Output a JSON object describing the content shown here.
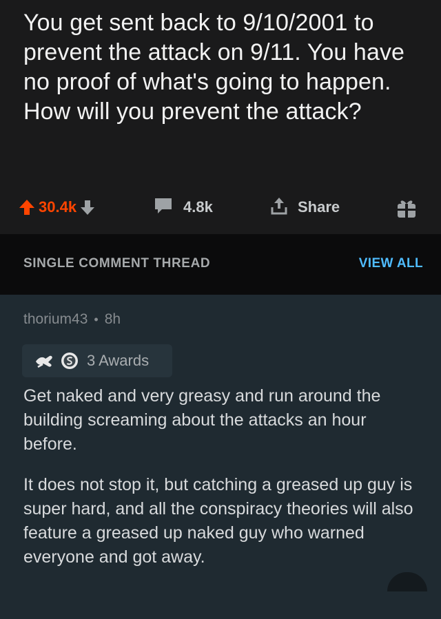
{
  "post": {
    "title": "You get sent back to 9/10/2001 to prevent the attack on 9/11. You have no proof of what's going to happen. How will you prevent the attack?",
    "score": "30.4k",
    "comments_count": "4.8k",
    "share_label": "Share",
    "upvote_color": "#ff4500"
  },
  "thread": {
    "label": "SINGLE COMMENT THREAD",
    "view_all": "VIEW ALL",
    "link_color": "#4fbcff"
  },
  "comment": {
    "author": "thorium43",
    "separator": "•",
    "age": "8h",
    "awards_label": "3 Awards",
    "paragraphs": [
      "Get naked and very greasy and run around the building screaming about the attacks an hour before.",
      "It does not stop it, but catching a greased up guy is super hard, and all the conspiracy theories will also feature a greased up naked guy who warned everyone and got away."
    ]
  },
  "icons": {
    "upvote": "arrow-up-icon",
    "downvote": "arrow-down-icon",
    "comments": "speech-bubble-icon",
    "share": "share-upload-icon",
    "award": "gift-icon"
  }
}
